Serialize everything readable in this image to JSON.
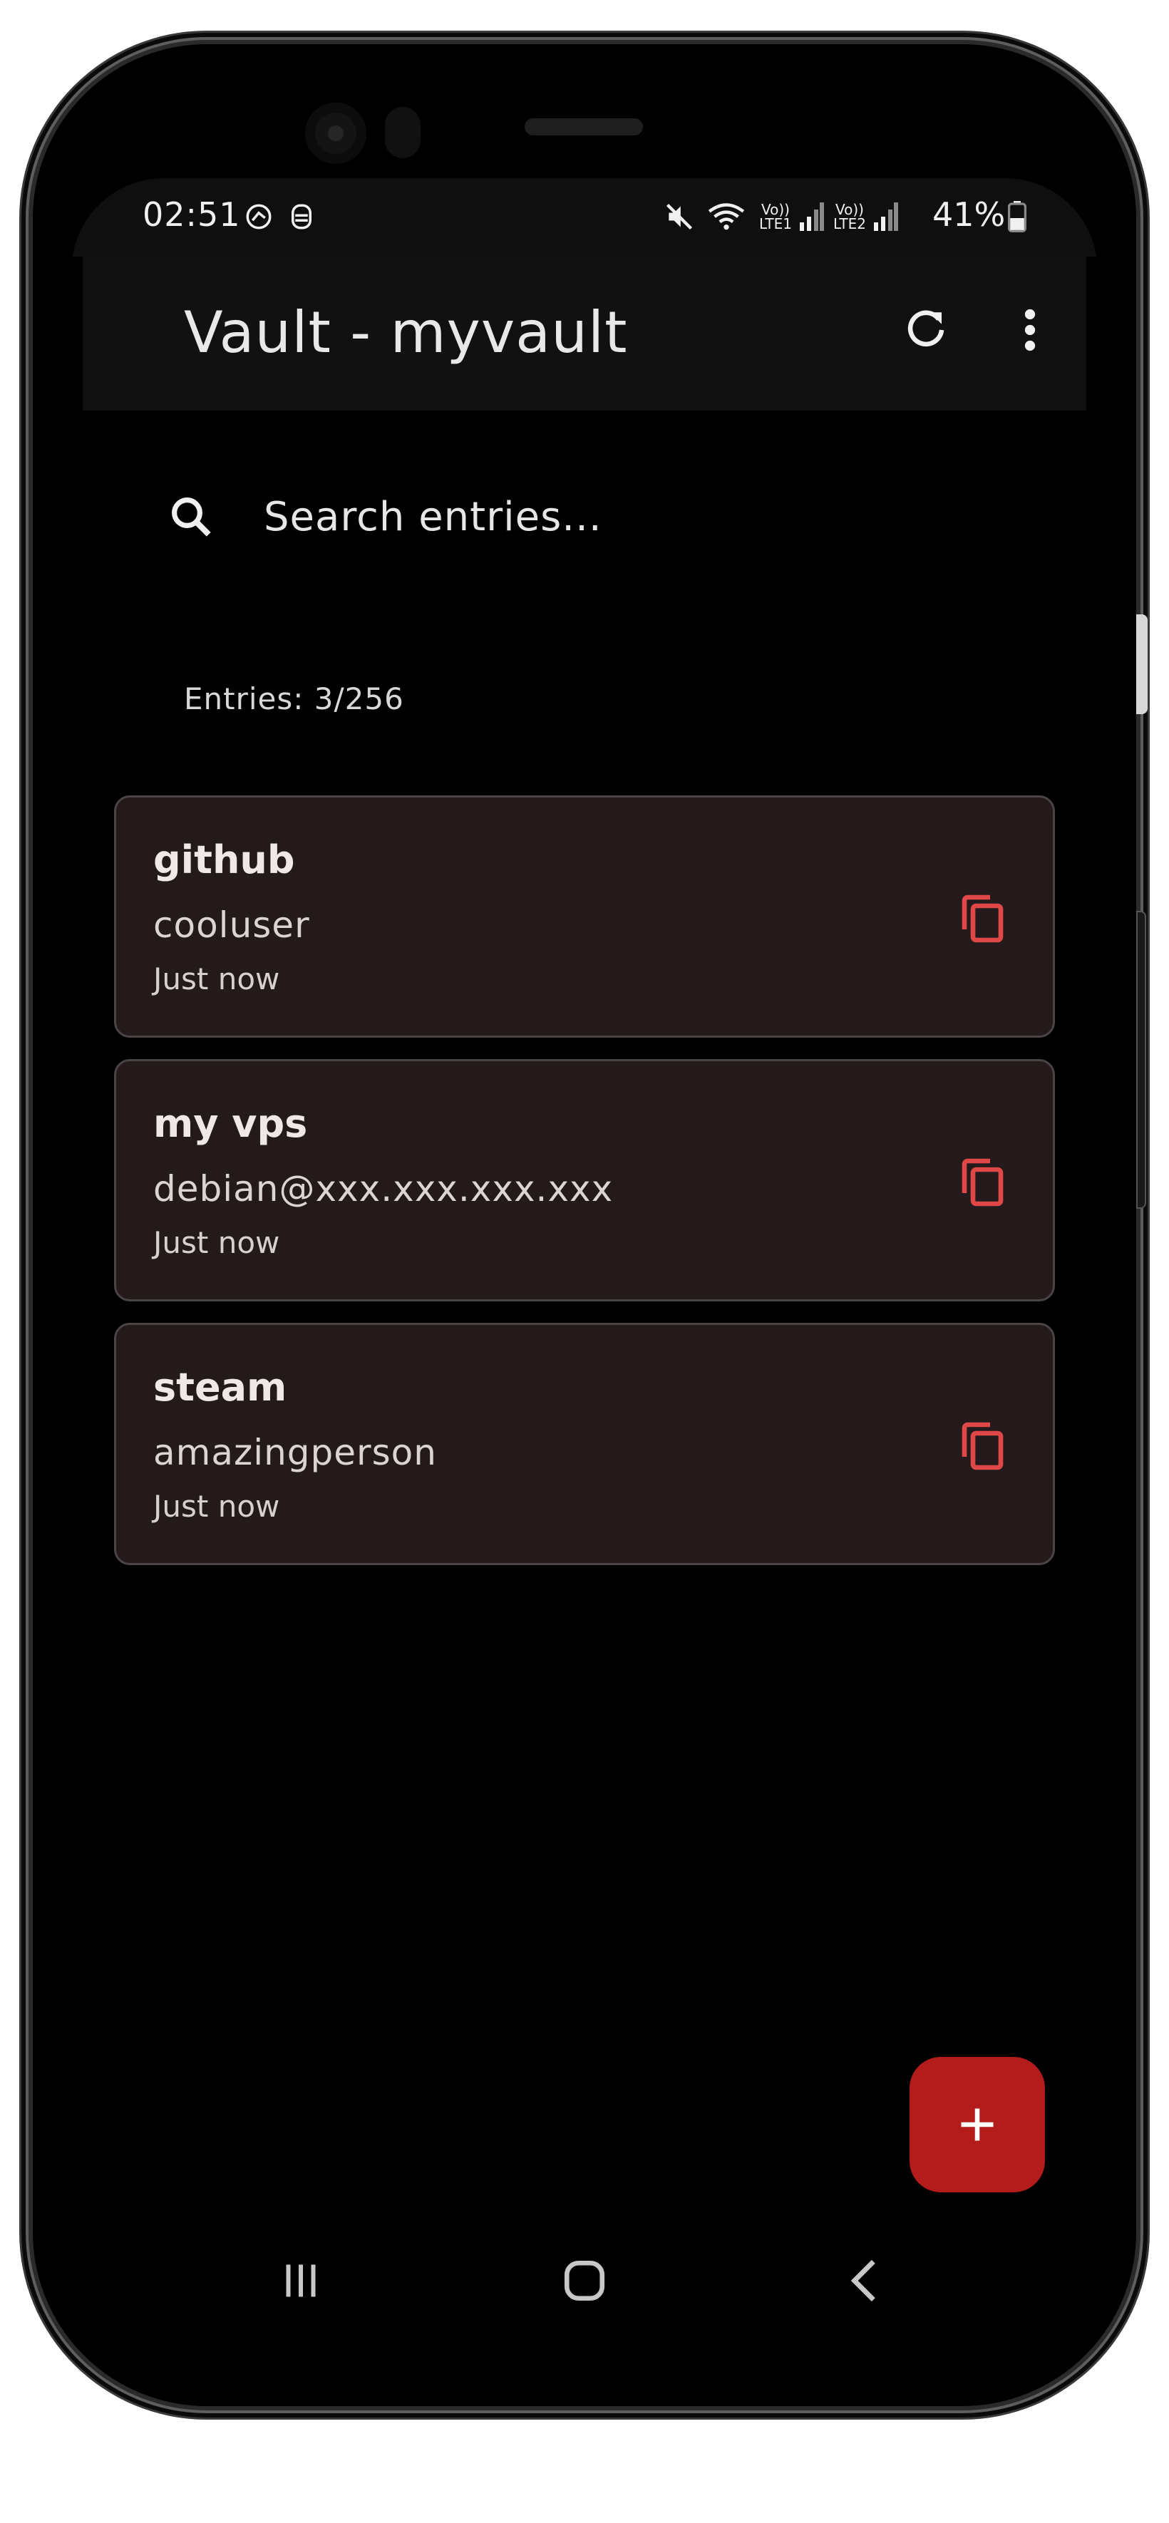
{
  "status_bar": {
    "time": "02:51",
    "battery": "41%",
    "sim1_label": "Vo))\nLTE1",
    "sim2_label": "Vo))\nLTE2"
  },
  "app_bar": {
    "title": "Vault - myvault"
  },
  "search": {
    "placeholder": "Search entries..."
  },
  "entries_count": "Entries: 3/256",
  "entries": [
    {
      "title": "github",
      "username": "cooluser",
      "modified": "Just now"
    },
    {
      "title": "my vps",
      "username": "debian@xxx.xxx.xxx.xxx",
      "modified": "Just now"
    },
    {
      "title": "steam",
      "username": "amazingperson",
      "modified": "Just now"
    }
  ],
  "colors": {
    "accent": "#b41c1c",
    "copy_icon": "#e04848",
    "card_bg": "#241a1b",
    "background": "#000000"
  },
  "icons": {
    "refresh": "refresh-icon",
    "menu": "more-vert-icon",
    "search": "search-icon",
    "copy": "copy-icon",
    "add": "plus-icon"
  }
}
